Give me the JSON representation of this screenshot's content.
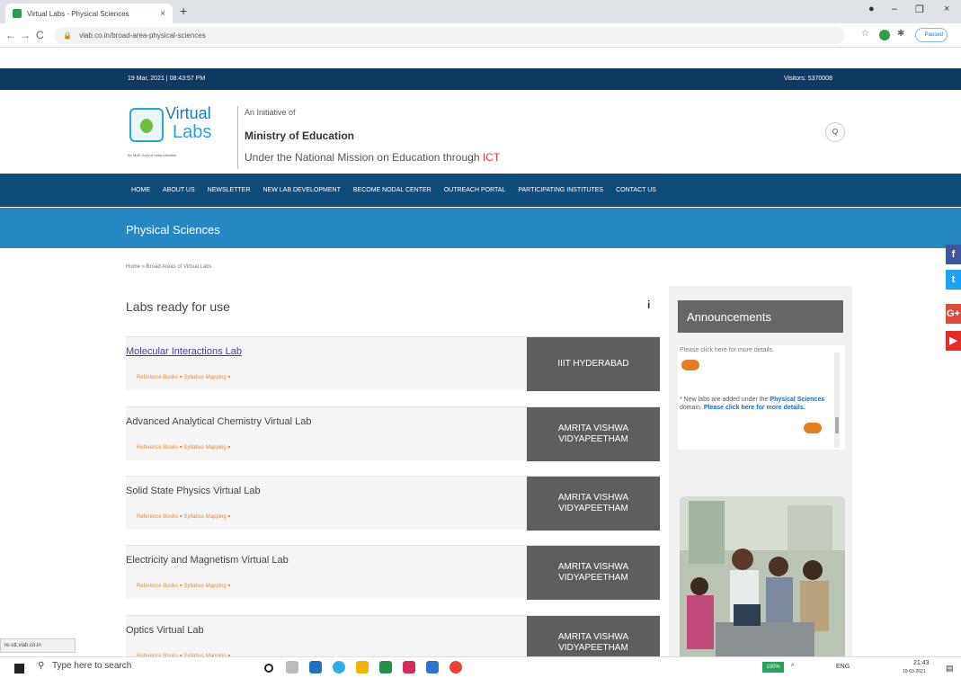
{
  "browser": {
    "tab_title": "Virtual Labs - Physical Sciences",
    "tab_close": "×",
    "new_tab": "+",
    "url": "vlab.co.in/broad-area-physical-sciences",
    "profile": "Paused",
    "window_min": "–",
    "window_max": "❐",
    "window_close": "×",
    "back": "←",
    "forward": "→",
    "reload": "C"
  },
  "site": {
    "datetime": "19 Mar, 2021 | 08:43:57 PM",
    "visitors": "Visitors: 5370008",
    "logo_virtual": "Virtual",
    "logo_labs": "Labs",
    "logo_tag": "An MoE Govt of India Initiative",
    "initiative_of": "An Initiative of",
    "ministry": "Ministry of Education",
    "mission_prefix": "Under the National Mission on Education through ",
    "mission_ict": "ICT",
    "search_icon": "Q",
    "nav": [
      "HOME",
      "ABOUT US",
      "NEWSLETTER",
      "NEW LAB DEVELOPMENT",
      "BECOME NODAL CENTER",
      "OUTREACH PORTAL",
      "PARTICIPATING INSTITUTES",
      "CONTACT US"
    ],
    "section_title": "Physical Sciences",
    "breadcrumb": "Home » Broad Areas of Virtual Labs",
    "labs_heading": "Labs ready for use",
    "info_icon": "i",
    "labs": [
      {
        "title": "Molecular Interactions Lab",
        "sub": "Reference Books ▾    Syllabus Mapping ▾",
        "institute": "IIIT HYDERABAD"
      },
      {
        "title": "Advanced Analytical Chemistry Virtual Lab",
        "sub": "Reference Books ▾    Syllabus Mapping ▾",
        "institute": "AMRITA VISHWA VIDYAPEETHAM"
      },
      {
        "title": "Solid State Physics Virtual Lab",
        "sub": "Reference Books ▾    Syllabus Mapping ▾",
        "institute": "AMRITA VISHWA VIDYAPEETHAM"
      },
      {
        "title": "Electricity and Magnetism Virtual Lab",
        "sub": "Reference Books ▾    Syllabus Mapping ▾",
        "institute": "AMRITA VISHWA VIDYAPEETHAM"
      },
      {
        "title": "Optics Virtual Lab",
        "sub": "Reference Books ▾    Syllabus Mapping ▾",
        "institute": "AMRITA VISHWA VIDYAPEETHAM"
      }
    ],
    "announcements": {
      "title": "Announcements",
      "line1": "Please click here for more details.",
      "line2_prefix": "* New labs are added under the ",
      "line2_area": "Physical Sciences",
      "line2_mid": " domain. ",
      "line2_link": "Please click here for more details."
    },
    "social": [
      "f",
      "t",
      "G+",
      "▶"
    ],
    "status_link": "re-stt.vlab.co.in"
  },
  "taskbar": {
    "search_placeholder": "Type here to search",
    "battery": "100%",
    "time": "21:43",
    "date": "19-03-2021",
    "lang": "ENG"
  },
  "colors": {
    "topbar": "#0e3a5f",
    "nav": "#0e4c7a",
    "section": "#2687c2",
    "institute_box": "#5e5e5e",
    "accent_orange": "#e98c3a",
    "ict_red": "#e53935"
  }
}
